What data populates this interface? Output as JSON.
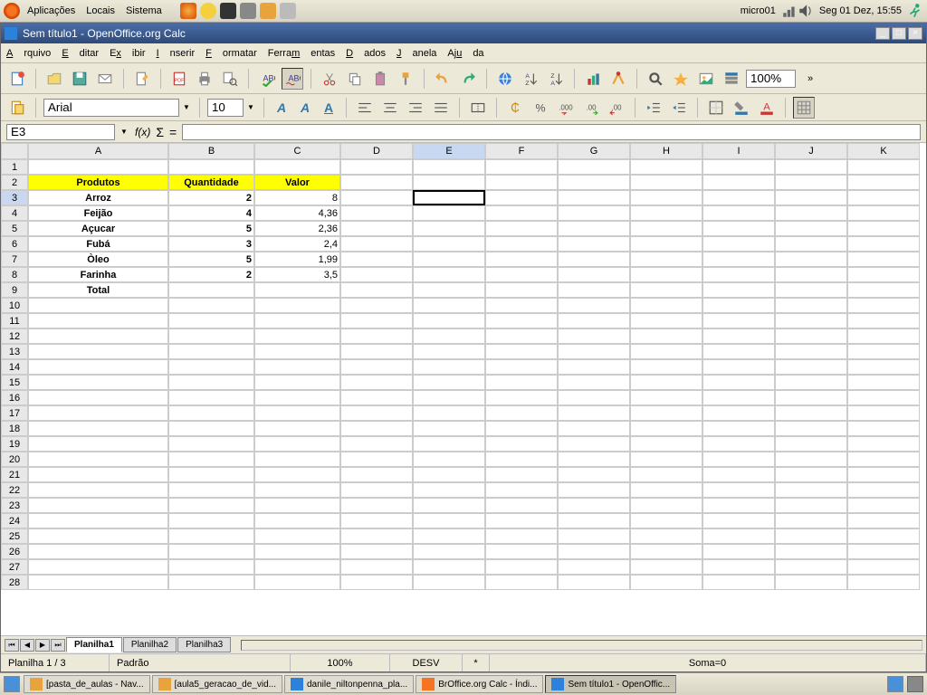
{
  "top": {
    "menus": [
      "Aplicações",
      "Locais",
      "Sistema"
    ],
    "user": "micro01",
    "clock": "Seg 01 Dez, 15:55"
  },
  "window": {
    "title": "Sem título1 - OpenOffice.org Calc",
    "menus": [
      {
        "label": "Arquivo",
        "m": "A"
      },
      {
        "label": "Editar",
        "m": "E"
      },
      {
        "label": "Exibir",
        "m": "x"
      },
      {
        "label": "Inserir",
        "m": "I"
      },
      {
        "label": "Formatar",
        "m": "F"
      },
      {
        "label": "Ferramentas",
        "m": "m"
      },
      {
        "label": "Dados",
        "m": "D"
      },
      {
        "label": "Janela",
        "m": "J"
      },
      {
        "label": "Ajuda",
        "m": "u"
      }
    ],
    "zoom_combo": "100%",
    "font": "Arial",
    "font_size": "10",
    "cell_ref": "E3",
    "formula": "",
    "columns": [
      "A",
      "B",
      "C",
      "D",
      "E",
      "F",
      "G",
      "H",
      "I",
      "J",
      "K"
    ],
    "col_widths": {
      "A": "col-A",
      "B": "col-B",
      "C": "col-C"
    },
    "selected_row": 3,
    "selected_col": "E",
    "data": {
      "2": {
        "A": {
          "v": "Produtos",
          "cls": "hdr-row"
        },
        "B": {
          "v": "Quantidade",
          "cls": "hdr-row"
        },
        "C": {
          "v": "Valor",
          "cls": "hdr-row"
        }
      },
      "3": {
        "A": {
          "v": "Arroz",
          "cls": "bold center"
        },
        "B": {
          "v": "2",
          "cls": "bold right"
        },
        "C": {
          "v": "8",
          "cls": "right"
        }
      },
      "4": {
        "A": {
          "v": "Feijão",
          "cls": "bold center"
        },
        "B": {
          "v": "4",
          "cls": "bold right"
        },
        "C": {
          "v": "4,36",
          "cls": "right"
        }
      },
      "5": {
        "A": {
          "v": "Açucar",
          "cls": "bold center"
        },
        "B": {
          "v": "5",
          "cls": "bold right"
        },
        "C": {
          "v": "2,36",
          "cls": "right"
        }
      },
      "6": {
        "A": {
          "v": "Fubá",
          "cls": "bold center"
        },
        "B": {
          "v": "3",
          "cls": "bold right"
        },
        "C": {
          "v": "2,4",
          "cls": "right"
        }
      },
      "7": {
        "A": {
          "v": "Òleo",
          "cls": "bold center"
        },
        "B": {
          "v": "5",
          "cls": "bold right"
        },
        "C": {
          "v": "1,99",
          "cls": "right"
        }
      },
      "8": {
        "A": {
          "v": "Farinha",
          "cls": "bold center"
        },
        "B": {
          "v": "2",
          "cls": "bold right"
        },
        "C": {
          "v": "3,5",
          "cls": "right"
        }
      },
      "9": {
        "A": {
          "v": "Total",
          "cls": "bold center"
        }
      }
    },
    "sheet_tabs": [
      "Planilha1",
      "Planilha2",
      "Planilha3"
    ],
    "active_tab": 0,
    "status": {
      "sheet": "Planilha 1 / 3",
      "style": "Padrão",
      "zoom": "100%",
      "mode": "DESV",
      "modified": "*",
      "sum": "Soma=0"
    }
  },
  "taskbar": [
    {
      "label": "[pasta_de_aulas - Nav...",
      "icon": "#e8a33d"
    },
    {
      "label": "[aula5_geracao_de_vid...",
      "icon": "#e8a33d"
    },
    {
      "label": "danile_niltonpenna_pla...",
      "icon": "#2a82da"
    },
    {
      "label": "BrOffice.org Calc - Índi...",
      "icon": "#f47421"
    },
    {
      "label": "Sem título1 - OpenOffic...",
      "icon": "#2a82da",
      "active": true
    }
  ]
}
